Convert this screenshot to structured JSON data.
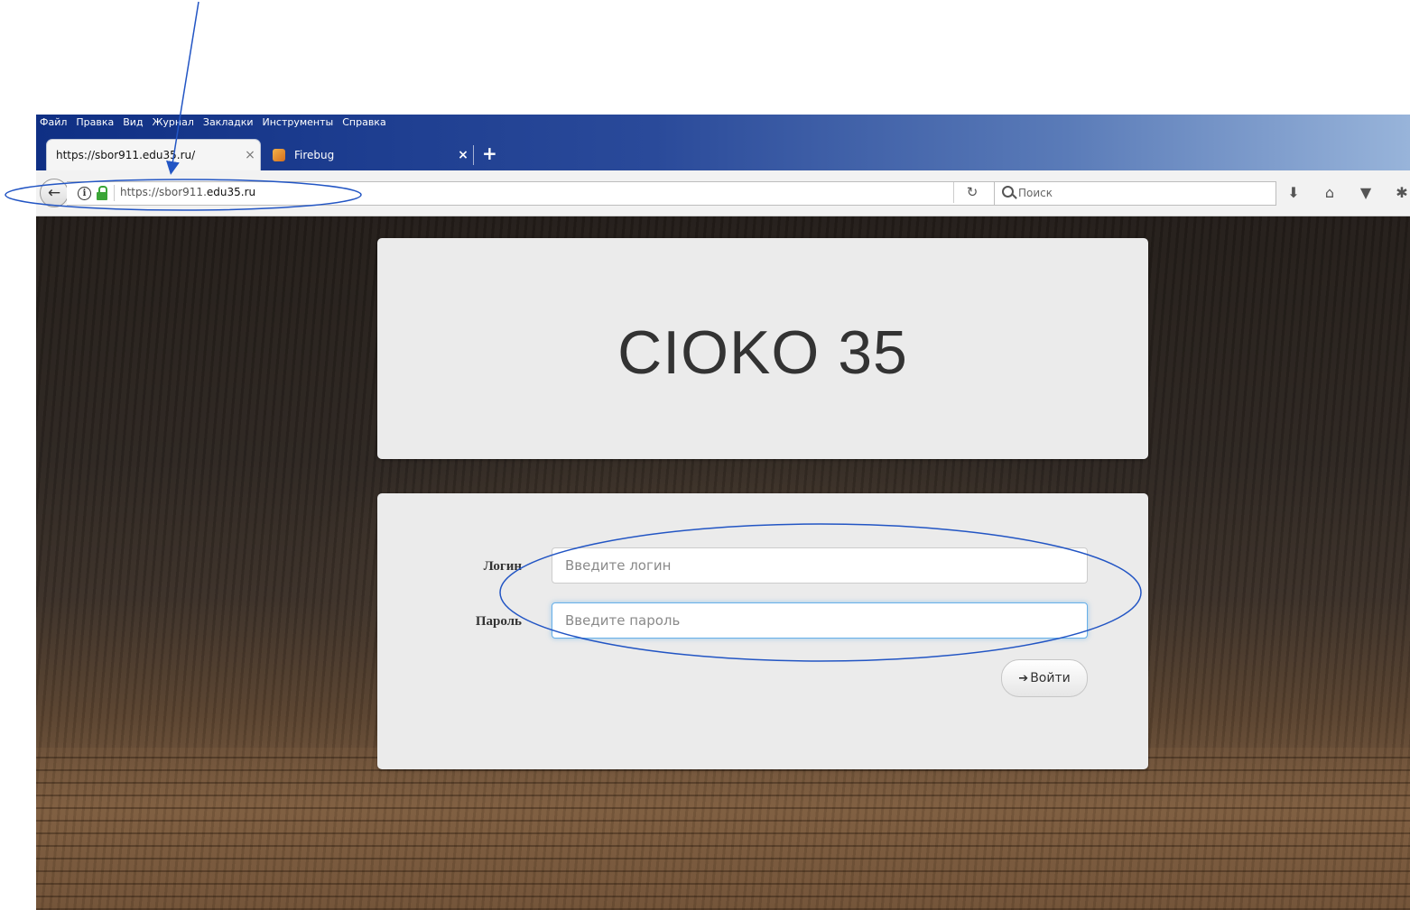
{
  "browser": {
    "menu": [
      "Файл",
      "Правка",
      "Вид",
      "Журнал",
      "Закладки",
      "Инструменты",
      "Справка"
    ],
    "tabs": [
      {
        "label": "https://sbor911.edu35.ru/",
        "close": "×"
      },
      {
        "label": "Firebug",
        "close": "×"
      }
    ],
    "new_tab": "+",
    "address": {
      "prefix": "https://sbor911.",
      "domain": "edu35.ru"
    },
    "search_placeholder": "Поиск"
  },
  "page": {
    "title": "CIOKO 35",
    "login_label": "Логин",
    "login_placeholder": "Введите логин",
    "password_label": "Пароль",
    "password_placeholder": "Введите пароль",
    "submit_label": "Войти"
  },
  "annotation_color": "#2255c4"
}
